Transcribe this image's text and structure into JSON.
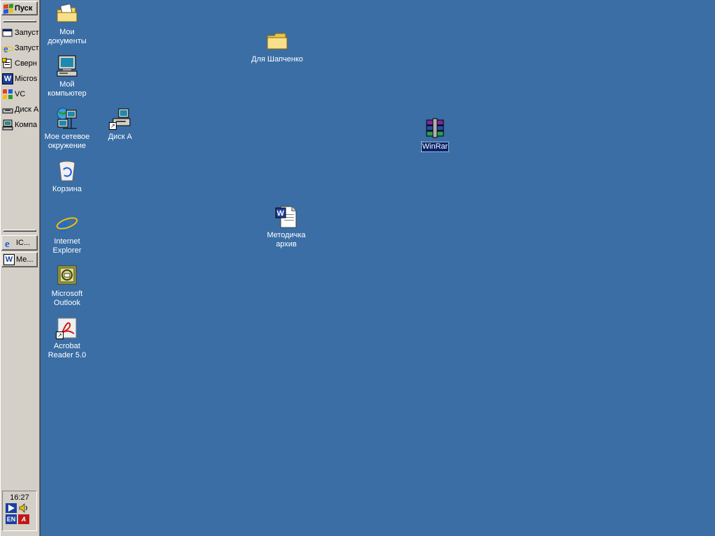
{
  "taskbar": {
    "start_label": "Пуск",
    "quick_launch": [
      {
        "icon": "launch-icon",
        "label": "Запуст"
      },
      {
        "icon": "ie-icon",
        "label": "Запуст"
      },
      {
        "icon": "notepad-icon",
        "label": "Сверн"
      },
      {
        "icon": "word-icon",
        "label": "Micros"
      },
      {
        "icon": "vc-icon",
        "label": "VC"
      },
      {
        "icon": "drive-icon",
        "label": "Диск А"
      },
      {
        "icon": "computer-icon",
        "label": "Компа"
      }
    ],
    "tasks": [
      {
        "icon": "ie-icon",
        "label": "IC..."
      },
      {
        "icon": "word-icon",
        "label": "Ме..."
      }
    ],
    "clock": "16:27",
    "tray": {
      "language": "EN"
    }
  },
  "desktop": {
    "icons": [
      {
        "id": "my-documents",
        "label": "Мои документы"
      },
      {
        "id": "my-computer",
        "label": "Мой компьютер"
      },
      {
        "id": "network",
        "label": "Мое сетевое окружение"
      },
      {
        "id": "disk-a",
        "label": "Диск А"
      },
      {
        "id": "recycle-bin",
        "label": "Корзина"
      },
      {
        "id": "internet-explorer",
        "label": "Internet Explorer"
      },
      {
        "id": "outlook",
        "label": "Microsoft Outlook"
      },
      {
        "id": "acrobat",
        "label": "Acrobat Reader 5.0"
      },
      {
        "id": "folder-shapchenko",
        "label": "Для Шапченко"
      },
      {
        "id": "winrar",
        "label": "WinRar"
      },
      {
        "id": "metodichka",
        "label": "Методичка архив"
      }
    ]
  },
  "colors": {
    "desktop_background": "#3a6ea5",
    "taskbar_face": "#d4d0c8",
    "selection": "#0a246a"
  }
}
